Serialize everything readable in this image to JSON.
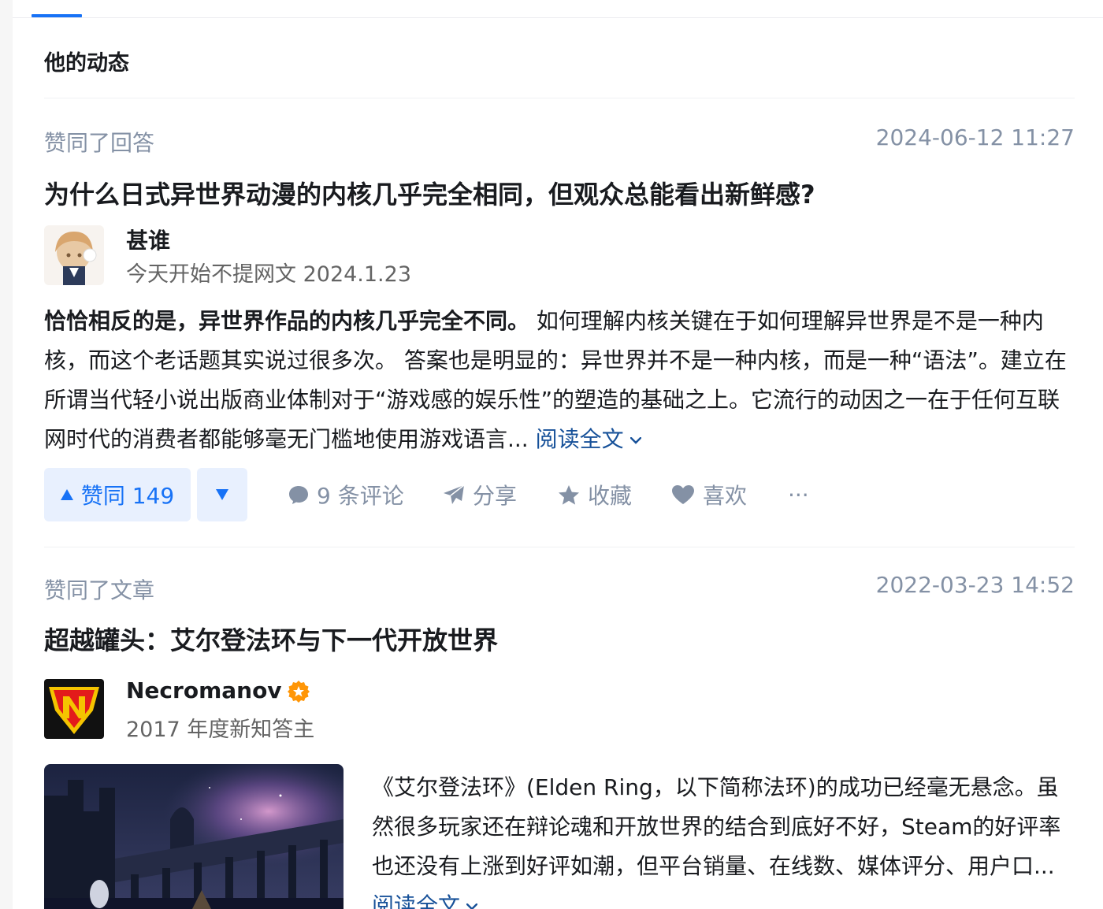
{
  "section": {
    "title": "他的动态"
  },
  "items": [
    {
      "type": "赞同了回答",
      "time": "2024-06-12 11:27",
      "title": "为什么日式异世界动漫的内核几乎完全相同，但观众总能看出新鲜感?",
      "author": {
        "name": "甚谁",
        "bio": "今天开始不提网文 2024.1.23"
      },
      "excerpt_bold": "恰恰相反的是，异世界作品的内核几乎完全不同。",
      "excerpt": " 如何理解内核关键在于如何理解异世界是不是一种内核，而这个老话题其实说过很多次。 答案也是明显的：异世界并不是一种内核，而是一种“语法”。建立在所谓当代轻小说出版商业体制对于“游戏感的娱乐性”的塑造的基础之上。它流行的动因之一在于任何互联网时代的消费者都能够毫无门槛地使用游戏语言...",
      "read_more": "阅读全文",
      "actions": {
        "vote_up": "赞同 149",
        "comments": "9 条评论",
        "share": "分享",
        "collect": "收藏",
        "like": "喜欢",
        "more": "···"
      }
    },
    {
      "type": "赞同了文章",
      "time": "2022-03-23 14:52",
      "title": "超越罐头：艾尔登法环与下一代开放世界",
      "author": {
        "name": "Necromanov",
        "bio": "2017 年度新知答主"
      },
      "excerpt": "《艾尔登法环》(Elden Ring，以下简称法环)的成功已经毫无悬念。虽然很多玩家还在辩论魂和开放世界的结合到底好不好，Steam的好评率也还没有上涨到好评如潮，但平台销量、在线数、媒体评分、用户口...",
      "read_more": "阅读全文"
    }
  ],
  "colors": {
    "accent": "#1772f6",
    "meta": "#8491a5",
    "link": "#175199"
  }
}
